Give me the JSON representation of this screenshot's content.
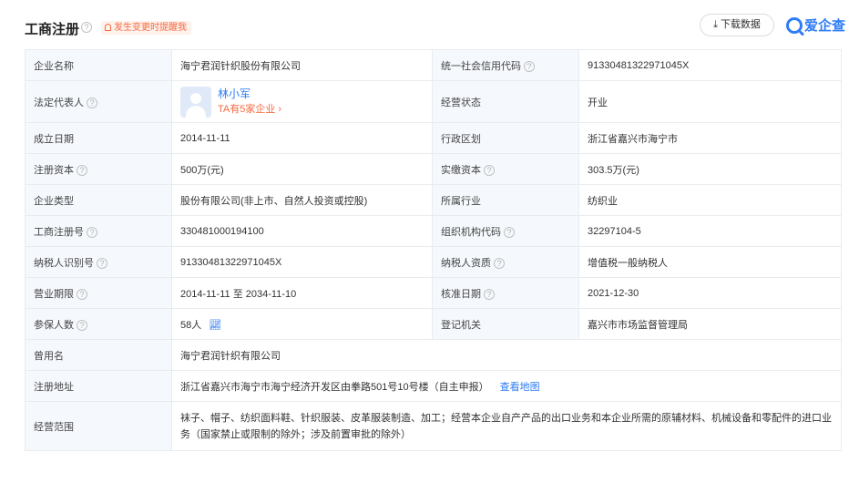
{
  "header": {
    "title": "工商注册",
    "remind": "发生变更时提醒我",
    "download": "下载数据",
    "brand": "爱企查"
  },
  "rows": [
    {
      "l1": "企业名称",
      "v1": "海宁君润针织股份有限公司",
      "l2": "统一社会信用代码",
      "v2": "91330481322971045X"
    },
    {
      "l1": "法定代表人",
      "rep_name": "林小军",
      "rep_count": "TA有5家企业 ›",
      "l2": "经营状态",
      "v2": "开业"
    },
    {
      "l1": "成立日期",
      "v1": "2014-11-11",
      "l2": "行政区划",
      "v2": "浙江省嘉兴市海宁市"
    },
    {
      "l1": "注册资本",
      "v1": "500万(元)",
      "l2": "实缴资本",
      "v2": "303.5万(元)"
    },
    {
      "l1": "企业类型",
      "v1": "股份有限公司(非上市、自然人投资或控股)",
      "l2": "所属行业",
      "v2": "纺织业"
    },
    {
      "l1": "工商注册号",
      "v1": "330481000194100",
      "l2": "组织机构代码",
      "v2": "32297104-5"
    },
    {
      "l1": "纳税人识别号",
      "v1": "91330481322971045X",
      "l2": "纳税人资质",
      "v2": "增值税一般纳税人"
    },
    {
      "l1": "营业期限",
      "v1": "2014-11-11 至 2034-11-10",
      "l2": "核准日期",
      "v2": "2021-12-30"
    },
    {
      "l1": "参保人数",
      "v1": "58人",
      "l2": "登记机关",
      "v2": "嘉兴市市场监督管理局"
    },
    {
      "l1": "曾用名",
      "v1": "海宁君润针织有限公司"
    },
    {
      "l1": "注册地址",
      "v1": "浙江省嘉兴市海宁市海宁经济开发区由拳路501号10号楼（自主申报）",
      "map_link": "查看地图"
    },
    {
      "l1": "经营范围",
      "v1": "袜子、帽子、纺织面料鞋、针织服装、皮革服装制造、加工；经营本企业自产产品的出口业务和本企业所需的原辅材料、机械设备和零配件的进口业务（国家禁止或限制的除外；涉及前置审批的除外）"
    }
  ]
}
